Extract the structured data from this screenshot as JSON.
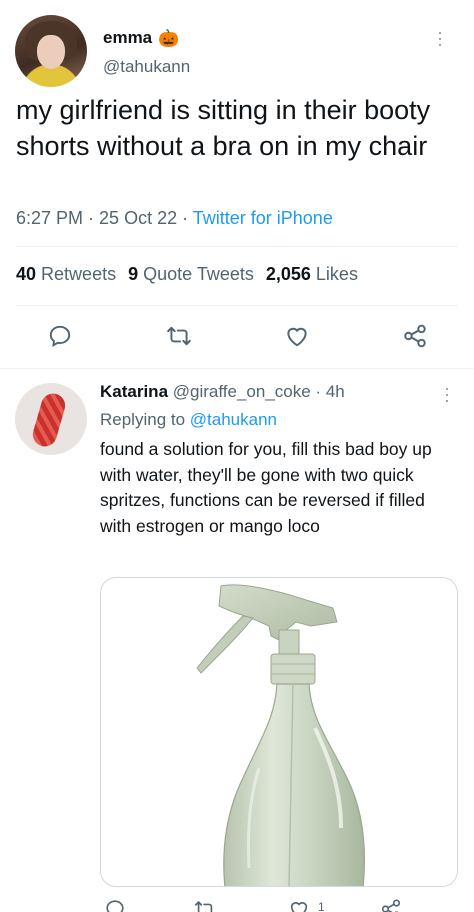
{
  "tweet": {
    "display_name": "emma",
    "name_emoji": "🎃",
    "handle": "@tahukann",
    "text": "my girlfriend is sitting in their booty shorts without a bra on in my chair",
    "time": "6:27 PM",
    "date": "25 Oct 22",
    "separator": " · ",
    "source": "Twitter for iPhone",
    "stats": {
      "retweets_count": "40",
      "retweets_label": "Retweets",
      "quotes_count": "9",
      "quotes_label": "Quote Tweets",
      "likes_count": "2,056",
      "likes_label": "Likes"
    },
    "action_icons": [
      "reply-icon",
      "retweet-icon",
      "like-icon",
      "share-icon"
    ]
  },
  "reply": {
    "display_name": "Katarina",
    "handle": "@giraffe_on_coke",
    "time_sep": " · ",
    "time": "4h",
    "replying_prefix": "Replying to ",
    "replying_to": "@tahukann",
    "text": "found a solution for you, fill this bad boy up with water, they'll be gone with two quick spritzes, functions can be reversed if filled with estrogen or mango loco",
    "like_count": "1",
    "media": "spray-bottle-image"
  },
  "colors": {
    "text": "#0f1419",
    "secondary": "#536471",
    "link": "#1d9bf0",
    "divider": "#eff3f4"
  }
}
